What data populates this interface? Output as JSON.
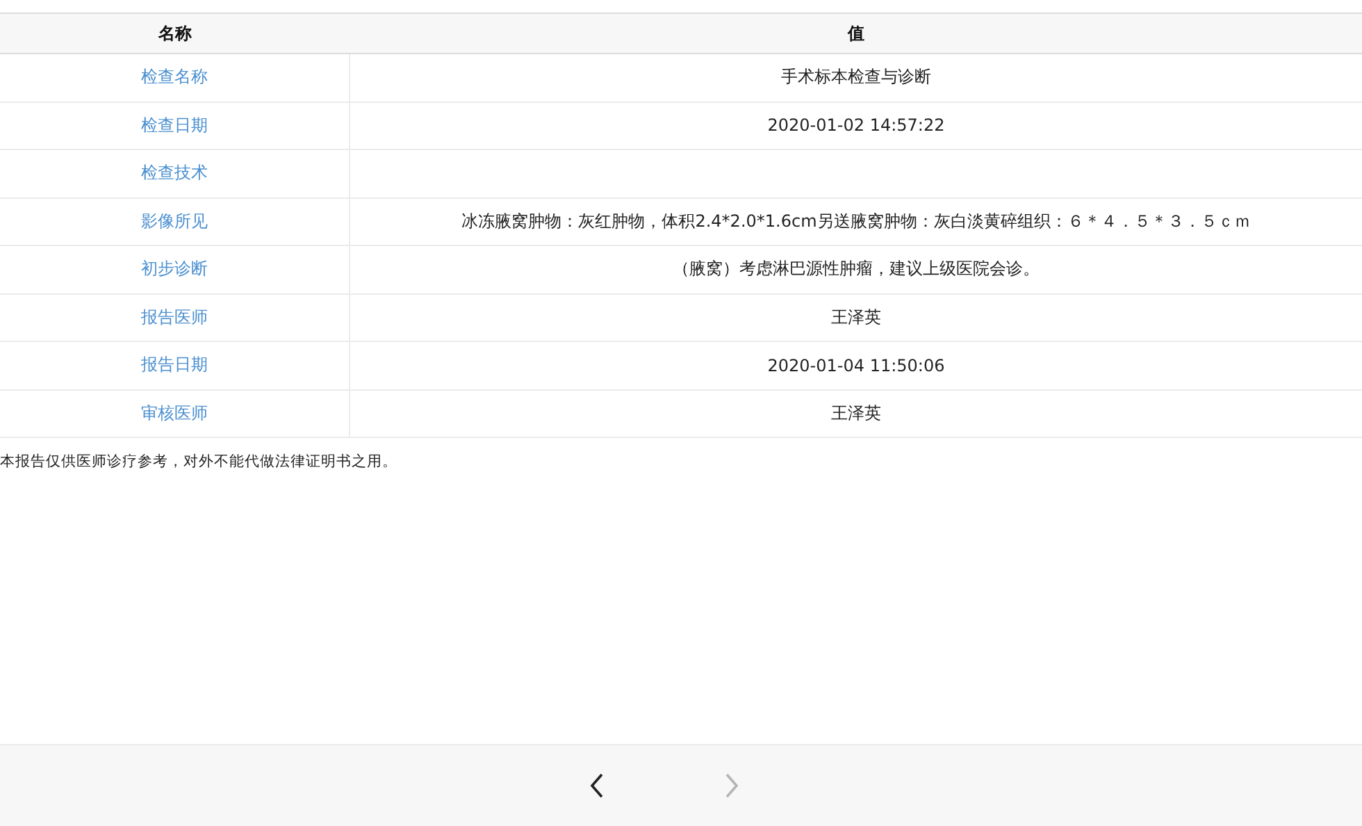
{
  "table": {
    "columns": [
      "名称",
      "值"
    ],
    "rows": [
      {
        "name": "检查名称",
        "value": "手术标本检查与诊断"
      },
      {
        "name": "检查日期",
        "value": "2020-01-02 14:57:22"
      },
      {
        "name": "检查技术"
      },
      {
        "name": "影像所见",
        "value": "冰冻腋窝肿物：灰红肿物，体积2.4*2.0*1.6cm另送腋窝肿物：灰白淡黄碎组织：６＊４．５＊３．５ｃｍ"
      },
      {
        "name": "初步诊断",
        "value": "（腋窝）考虑淋巴源性肿瘤，建议上级医院会诊。"
      },
      {
        "name": "报告医师",
        "value": "王泽英"
      },
      {
        "name": "报告日期",
        "value": "2020-01-04 11:50:06"
      },
      {
        "name": "审核医师",
        "value": "王泽英"
      }
    ]
  },
  "note": "本报告仅供医师诊疗参考，对外不能代做法律证明书之用。",
  "toolbar": {
    "buttons": [
      {
        "kind": "back",
        "disabled": false
      },
      {
        "kind": "forward",
        "disabled": true
      }
    ]
  }
}
